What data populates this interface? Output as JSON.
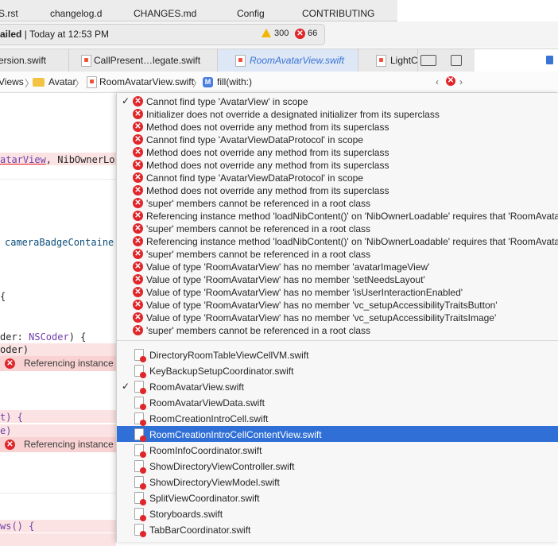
{
  "top_files": [
    "S.rst",
    "changelog.d",
    "CHANGES.md",
    "Config",
    "CONTRIBUTING"
  ],
  "status": {
    "state": "ailed",
    "time": "| Today at 12:53 PM",
    "warnings": "300",
    "errors": "66"
  },
  "tabs": [
    {
      "label": "ersion.swift"
    },
    {
      "label": "CallPresent…legate.swift"
    },
    {
      "label": "RoomAvatarView.swift"
    },
    {
      "label": "LightC"
    }
  ],
  "jumpbar": {
    "crumb1": "Views",
    "crumb2": "Avatar",
    "crumb3": "RoomAvatarView.swift",
    "method_icon": "M",
    "crumb4": "fill(with:)"
  },
  "code": {
    "line1_type": "atarView",
    "line1_rest": ", NibOwnerLo",
    "line2_rest": "cameraBadgeContaine",
    "line3": "{",
    "line4_pre": "der: ",
    "line4_type": "NSCoder",
    "line4_post": ") {",
    "line5": "oder)",
    "line6_pre": "t) {",
    "line7": "e)",
    "line8_pre": "ws() {",
    "err_label": "Referencing instance"
  },
  "menu": {
    "issues": [
      {
        "text": "Cannot find type 'AvatarView' in scope",
        "checked": true
      },
      {
        "text": "Initializer does not override a designated initializer from its superclass"
      },
      {
        "text": "Method does not override any method from its superclass"
      },
      {
        "text": "Cannot find type 'AvatarViewDataProtocol' in scope"
      },
      {
        "text": "Method does not override any method from its superclass"
      },
      {
        "text": "Method does not override any method from its superclass"
      },
      {
        "text": "Cannot find type 'AvatarViewDataProtocol' in scope"
      },
      {
        "text": "Method does not override any method from its superclass"
      },
      {
        "text": "'super' members cannot be referenced in a root class"
      },
      {
        "text": "Referencing instance method 'loadNibContent()' on 'NibOwnerLoadable' requires that 'RoomAvatarV"
      },
      {
        "text": "'super' members cannot be referenced in a root class"
      },
      {
        "text": "Referencing instance method 'loadNibContent()' on 'NibOwnerLoadable' requires that 'RoomAvatarV"
      },
      {
        "text": "'super' members cannot be referenced in a root class"
      },
      {
        "text": "Value of type 'RoomAvatarView' has no member 'avatarImageView'"
      },
      {
        "text": "Value of type 'RoomAvatarView' has no member 'setNeedsLayout'"
      },
      {
        "text": "Value of type 'RoomAvatarView' has no member 'isUserInteractionEnabled'"
      },
      {
        "text": "Value of type 'RoomAvatarView' has no member 'vc_setupAccessibilityTraitsButton'"
      },
      {
        "text": "Value of type 'RoomAvatarView' has no member 'vc_setupAccessibilityTraitsImage'"
      },
      {
        "text": "'super' members cannot be referenced in a root class"
      }
    ],
    "files": [
      {
        "name": "DirectoryRoomTableViewCellVM.swift"
      },
      {
        "name": "KeyBackupSetupCoordinator.swift"
      },
      {
        "name": "RoomAvatarView.swift",
        "checked": true
      },
      {
        "name": "RoomAvatarViewData.swift"
      },
      {
        "name": "RoomCreationIntroCell.swift"
      },
      {
        "name": "RoomCreationIntroCellContentView.swift",
        "selected": true
      },
      {
        "name": "RoomInfoCoordinator.swift"
      },
      {
        "name": "ShowDirectoryViewController.swift"
      },
      {
        "name": "ShowDirectoryViewModel.swift"
      },
      {
        "name": "SplitViewCoordinator.swift"
      },
      {
        "name": "Storyboards.swift"
      },
      {
        "name": "TabBarCoordinator.swift"
      }
    ],
    "checkmark": "✓"
  },
  "colors": {
    "error": "#e0262a",
    "warning": "#f2b600",
    "selection": "#2f6fd6",
    "error_line": "#fbe3e3"
  }
}
